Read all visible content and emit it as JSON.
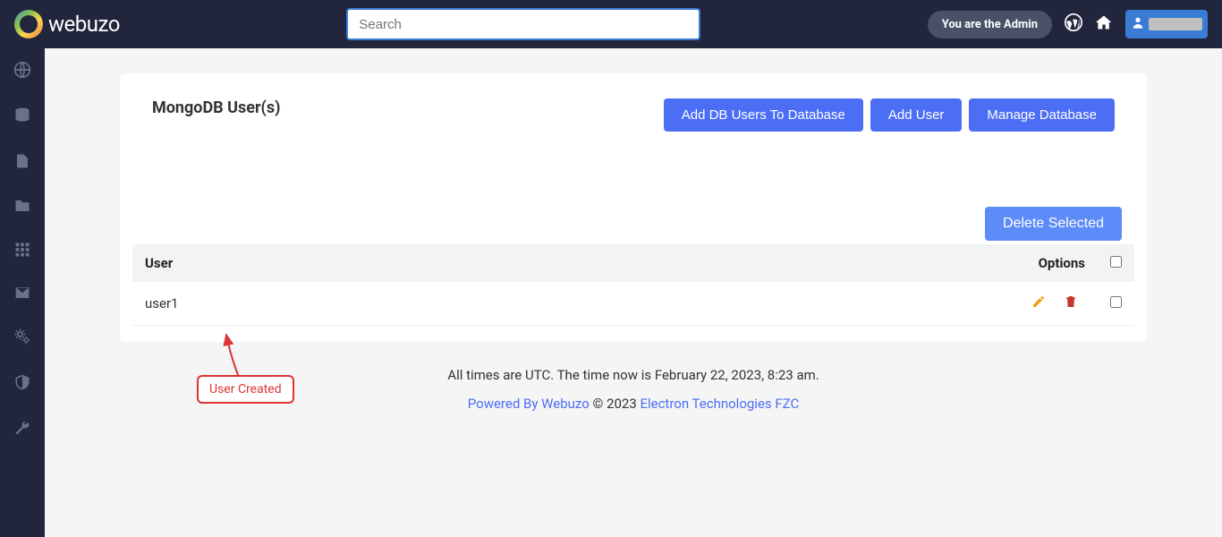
{
  "header": {
    "brand": "webuzo",
    "search_placeholder": "Search",
    "admin_label": "You are the Admin"
  },
  "page": {
    "title": "MongoDB User(s)",
    "buttons": {
      "add_db_users": "Add DB Users To Database",
      "add_user": "Add User",
      "manage_db": "Manage Database",
      "delete_selected": "Delete Selected"
    }
  },
  "table": {
    "col_user": "User",
    "col_options": "Options",
    "rows": [
      {
        "user": "user1"
      }
    ]
  },
  "annotation": {
    "label": "User Created"
  },
  "footer": {
    "time_text": "All times are UTC. The time now is February 22, 2023, 8:23 am.",
    "powered": "Powered By Webuzo",
    "copyright": " © 2023 ",
    "company": "Electron Technologies FZC"
  }
}
